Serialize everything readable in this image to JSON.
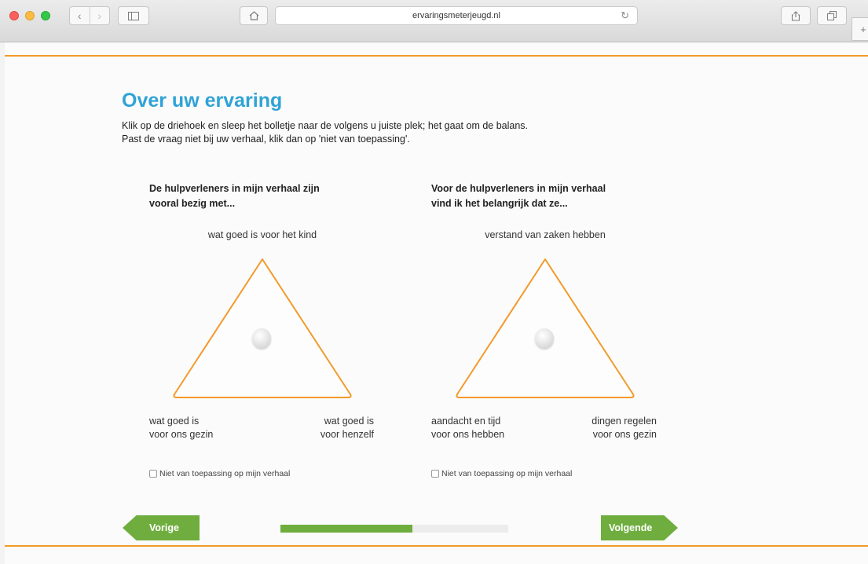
{
  "browser": {
    "url": "ervaringsmeterjeugd.nl"
  },
  "page": {
    "title": "Over uw ervaring",
    "intro_line1": "Klik op de driehoek en sleep het bolletje naar de volgens u juiste plek; het gaat om de balans.",
    "intro_line2": "Past de vraag niet bij uw verhaal, klik dan op 'niet van toepassing'."
  },
  "questions": [
    {
      "title_line1": "De hulpverleners in mijn verhaal zijn",
      "title_line2": "vooral bezig met...",
      "top_label": "wat goed is voor het kind",
      "left_label_line1": "wat goed is",
      "left_label_line2": "voor ons gezin",
      "right_label_line1": "wat goed is",
      "right_label_line2": "voor henzelf",
      "not_applicable": "Niet van toepassing op mijn verhaal"
    },
    {
      "title_line1": "Voor de hulpverleners in mijn verhaal",
      "title_line2": "vind ik het belangrijk dat ze...",
      "top_label": "verstand van zaken hebben",
      "left_label_line1": "aandacht en tijd",
      "left_label_line2": "voor ons hebben",
      "right_label_line1": "dingen regelen",
      "right_label_line2": "voor ons gezin",
      "not_applicable": "Niet van toepassing op mijn verhaal"
    }
  ],
  "navigation": {
    "prev_label": "Vorige",
    "next_label": "Volgende",
    "progress_percent": 58
  },
  "colors": {
    "accent_orange": "#f39a2a",
    "title_blue": "#2fa3d6",
    "button_green": "#6fae3e"
  }
}
